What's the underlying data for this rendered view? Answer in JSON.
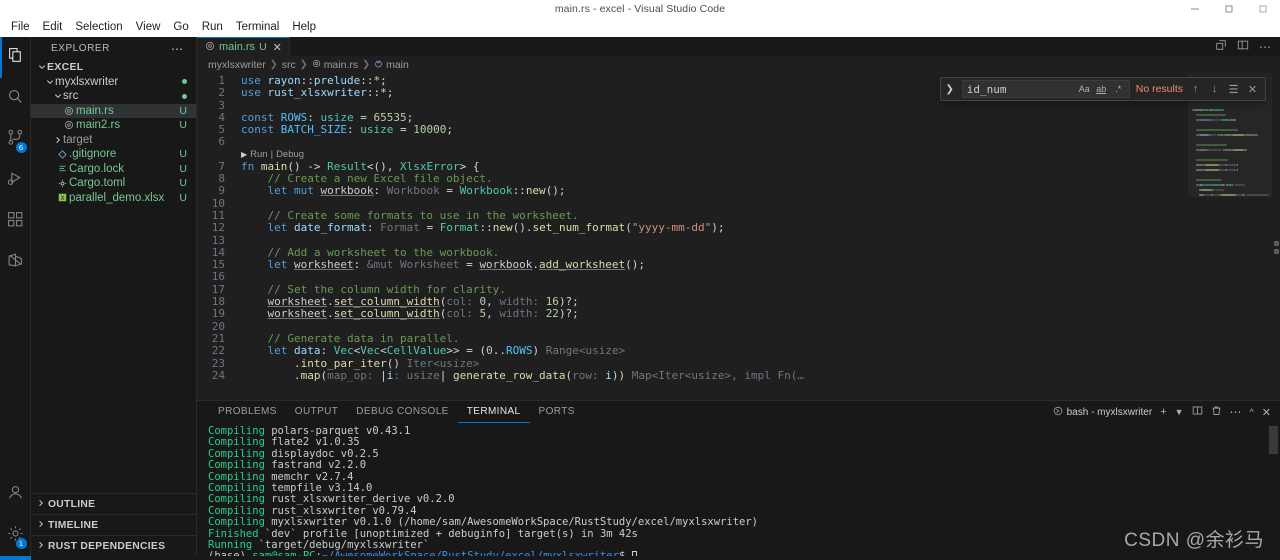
{
  "window": {
    "title": "main.rs - excel - Visual Studio Code",
    "controls": [
      "minimize",
      "maximize",
      "close"
    ]
  },
  "menubar": {
    "items": [
      "File",
      "Edit",
      "Selection",
      "View",
      "Go",
      "Run",
      "Terminal",
      "Help"
    ]
  },
  "activitybar": {
    "items": [
      {
        "name": "explorer",
        "icon": "files-icon",
        "active": true,
        "badge": ""
      },
      {
        "name": "search",
        "icon": "search-icon",
        "active": false,
        "badge": ""
      },
      {
        "name": "source-control",
        "icon": "source-control-icon",
        "active": false,
        "badge": "6"
      },
      {
        "name": "run-and-debug",
        "icon": "run-debug-icon",
        "active": false,
        "badge": ""
      },
      {
        "name": "extensions",
        "icon": "extensions-icon",
        "active": false,
        "badge": ""
      },
      {
        "name": "remote-explorer",
        "icon": "remote-icon",
        "active": false,
        "badge": ""
      }
    ],
    "bottom": [
      {
        "name": "accounts",
        "icon": "account-icon",
        "badge": ""
      },
      {
        "name": "manage",
        "icon": "gear-icon",
        "badge": "1"
      }
    ]
  },
  "sidebar": {
    "header": "EXPLORER",
    "more_label": "⋯",
    "root": "EXCEL",
    "tree": [
      {
        "label": "myxlsxwriter",
        "indent": 1,
        "type": "folder",
        "expanded": true,
        "badge": "",
        "dot": true,
        "icon": ""
      },
      {
        "label": "src",
        "indent": 2,
        "type": "folder",
        "expanded": true,
        "badge": "",
        "dot": true,
        "icon": ""
      },
      {
        "label": "main.rs",
        "indent": 3,
        "type": "file",
        "expanded": false,
        "badge": "U",
        "dot": false,
        "icon": "rust-icon",
        "selected": true
      },
      {
        "label": "main2.rs",
        "indent": 3,
        "type": "file",
        "expanded": false,
        "badge": "U",
        "dot": false,
        "icon": "rust-icon"
      },
      {
        "label": "target",
        "indent": 2,
        "type": "folder",
        "expanded": false,
        "badge": "",
        "dot": false,
        "icon": ""
      },
      {
        "label": ".gitignore",
        "indent": 2,
        "type": "file",
        "expanded": false,
        "badge": "U",
        "dot": false,
        "icon": "git-icon"
      },
      {
        "label": "Cargo.lock",
        "indent": 2,
        "type": "file",
        "expanded": false,
        "badge": "U",
        "dot": false,
        "icon": "lock-icon"
      },
      {
        "label": "Cargo.toml",
        "indent": 2,
        "type": "file",
        "expanded": false,
        "badge": "U",
        "dot": false,
        "icon": "toml-icon"
      },
      {
        "label": "parallel_demo.xlsx",
        "indent": 2,
        "type": "file",
        "expanded": false,
        "badge": "U",
        "dot": false,
        "icon": "excel-icon"
      }
    ],
    "sections": [
      "OUTLINE",
      "TIMELINE",
      "RUST DEPENDENCIES"
    ]
  },
  "editor": {
    "tab": {
      "label": "main.rs",
      "dirty_badge": "U",
      "close": "✕",
      "icon": "rust-icon"
    },
    "tab_actions": [
      "split-editor-icon",
      "layout-icon",
      "more-actions-icon"
    ],
    "breadcrumb": [
      "myxlsxwriter",
      "src",
      "main.rs",
      "main"
    ],
    "codelens": {
      "run": "Run",
      "sep": "|",
      "debug": "Debug"
    },
    "lines": [
      {
        "n": "1",
        "segs": [
          [
            "kw",
            "use "
          ],
          [
            "var",
            "rayon"
          ],
          [
            "op",
            "::"
          ],
          [
            "var",
            "prelude"
          ],
          [
            "op",
            "::*;"
          ]
        ]
      },
      {
        "n": "2",
        "segs": [
          [
            "kw",
            "use "
          ],
          [
            "var",
            "rust_xlsxwriter"
          ],
          [
            "op",
            "::*;"
          ]
        ]
      },
      {
        "n": "3",
        "segs": []
      },
      {
        "n": "4",
        "segs": [
          [
            "kw",
            "const "
          ],
          [
            "cst",
            "ROWS"
          ],
          [
            "op",
            ": "
          ],
          [
            "ty",
            "usize"
          ],
          [
            "op",
            " = "
          ],
          [
            "num",
            "65535"
          ],
          [
            "op",
            ";"
          ]
        ]
      },
      {
        "n": "5",
        "segs": [
          [
            "kw",
            "const "
          ],
          [
            "cst",
            "BATCH_SIZE"
          ],
          [
            "op",
            ": "
          ],
          [
            "ty",
            "usize"
          ],
          [
            "op",
            " = "
          ],
          [
            "num",
            "10000"
          ],
          [
            "op",
            ";"
          ]
        ]
      },
      {
        "n": "6",
        "segs": []
      },
      {
        "n": "7",
        "segs": [
          [
            "kw",
            "fn "
          ],
          [
            "fn",
            "main"
          ],
          [
            "op",
            "() -> "
          ],
          [
            "ty",
            "Result"
          ],
          [
            "op",
            "<(), "
          ],
          [
            "ty",
            "XlsxError"
          ],
          [
            "op",
            "> {"
          ]
        ],
        "codelens": true
      },
      {
        "n": "8",
        "segs": [
          [
            "cmt",
            "    // Create a new Excel file object."
          ]
        ]
      },
      {
        "n": "9",
        "segs": [
          [
            "kw",
            "    let "
          ],
          [
            "kw",
            "mut "
          ],
          [
            "und",
            "workbook"
          ],
          [
            "op",
            ": "
          ],
          [
            "ghost",
            "Workbook"
          ],
          [
            "op",
            " = "
          ],
          [
            "ty",
            "Workbook"
          ],
          [
            "op",
            "::"
          ],
          [
            "fn",
            "new"
          ],
          [
            "op",
            "();"
          ]
        ]
      },
      {
        "n": "10",
        "segs": []
      },
      {
        "n": "11",
        "segs": [
          [
            "cmt",
            "    // Create some formats to use in the worksheet."
          ]
        ]
      },
      {
        "n": "12",
        "segs": [
          [
            "kw",
            "    let "
          ],
          [
            "var",
            "date_format"
          ],
          [
            "op",
            ": "
          ],
          [
            "ghost",
            "Format"
          ],
          [
            "op",
            " = "
          ],
          [
            "ty",
            "Format"
          ],
          [
            "op",
            "::"
          ],
          [
            "fn",
            "new"
          ],
          [
            "op",
            "()."
          ],
          [
            "fn",
            "set_num_format"
          ],
          [
            "op",
            "("
          ],
          [
            "str",
            "\"yyyy-mm-dd\""
          ],
          [
            "op",
            ");"
          ]
        ]
      },
      {
        "n": "13",
        "segs": []
      },
      {
        "n": "14",
        "segs": [
          [
            "cmt",
            "    // Add a worksheet to the workbook."
          ]
        ]
      },
      {
        "n": "15",
        "segs": [
          [
            "kw",
            "    let "
          ],
          [
            "und",
            "worksheet"
          ],
          [
            "op",
            ": "
          ],
          [
            "ghost",
            "&mut Worksheet"
          ],
          [
            "op",
            " = "
          ],
          [
            "und",
            "workbook"
          ],
          [
            "op",
            "."
          ],
          [
            "und-fn",
            "add_worksheet"
          ],
          [
            "op",
            "();"
          ]
        ]
      },
      {
        "n": "16",
        "segs": []
      },
      {
        "n": "17",
        "segs": [
          [
            "cmt",
            "    // Set the column width for clarity."
          ]
        ]
      },
      {
        "n": "18",
        "segs": [
          [
            "op",
            "    "
          ],
          [
            "und",
            "worksheet"
          ],
          [
            "op",
            "."
          ],
          [
            "und-fn",
            "set_column_width"
          ],
          [
            "op",
            "("
          ],
          [
            "ghost",
            "col: "
          ],
          [
            "num",
            "0"
          ],
          [
            "op",
            ", "
          ],
          [
            "ghost",
            "width: "
          ],
          [
            "num",
            "16"
          ],
          [
            "op",
            ")?;"
          ]
        ]
      },
      {
        "n": "19",
        "segs": [
          [
            "op",
            "    "
          ],
          [
            "und",
            "worksheet"
          ],
          [
            "op",
            "."
          ],
          [
            "und-fn",
            "set_column_width"
          ],
          [
            "op",
            "("
          ],
          [
            "ghost",
            "col: "
          ],
          [
            "num",
            "5"
          ],
          [
            "op",
            ", "
          ],
          [
            "ghost",
            "width: "
          ],
          [
            "num",
            "22"
          ],
          [
            "op",
            ")?;"
          ]
        ]
      },
      {
        "n": "20",
        "segs": []
      },
      {
        "n": "21",
        "segs": [
          [
            "cmt",
            "    // Generate data in parallel."
          ]
        ]
      },
      {
        "n": "22",
        "segs": [
          [
            "kw",
            "    let "
          ],
          [
            "var",
            "data"
          ],
          [
            "op",
            ": "
          ],
          [
            "ty",
            "Vec"
          ],
          [
            "op",
            "<"
          ],
          [
            "ty",
            "Vec"
          ],
          [
            "op",
            "<"
          ],
          [
            "ty",
            "CellValue"
          ],
          [
            "op",
            ">> = ("
          ],
          [
            "num",
            "0"
          ],
          [
            "op",
            ".."
          ],
          [
            "cst",
            "ROWS"
          ],
          [
            "op",
            ")"
          ],
          [
            "ghost",
            " Range<usize>"
          ]
        ]
      },
      {
        "n": "23",
        "segs": [
          [
            "op",
            "        ."
          ],
          [
            "fn",
            "into_par_iter"
          ],
          [
            "op",
            "()"
          ],
          [
            "ghost",
            " Iter<usize>"
          ]
        ]
      },
      {
        "n": "24",
        "segs": [
          [
            "op",
            "        ."
          ],
          [
            "fn",
            "map"
          ],
          [
            "op",
            "("
          ],
          [
            "ghost",
            "map_op: "
          ],
          [
            "op",
            "|"
          ],
          [
            "var",
            "i"
          ],
          [
            "ghost",
            ": usize"
          ],
          [
            "op",
            "| "
          ],
          [
            "fn",
            "generate_row_data"
          ],
          [
            "op",
            "("
          ],
          [
            "ghost",
            "row: "
          ],
          [
            "var",
            "i"
          ],
          [
            "op",
            "))"
          ],
          [
            "ghost",
            " Map<Iter<usize>, impl Fn(…"
          ]
        ]
      }
    ]
  },
  "find_widget": {
    "toggle_icon": "chevron-right-icon",
    "query": "id_num",
    "options": [
      {
        "name": "match-case",
        "glyph": "Aa"
      },
      {
        "name": "match-whole-word",
        "glyph": "ab"
      },
      {
        "name": "use-regex",
        "glyph": ".*"
      }
    ],
    "result_text": "No results",
    "buttons": [
      {
        "name": "previous-match",
        "glyph": "↑"
      },
      {
        "name": "next-match",
        "glyph": "↓"
      },
      {
        "name": "find-in-selection",
        "glyph": "☰"
      },
      {
        "name": "close-find",
        "glyph": "✕"
      }
    ]
  },
  "panel": {
    "tabs": [
      {
        "label": "PROBLEMS",
        "active": false
      },
      {
        "label": "OUTPUT",
        "active": false
      },
      {
        "label": "DEBUG CONSOLE",
        "active": false
      },
      {
        "label": "TERMINAL",
        "active": true
      },
      {
        "label": "PORTS",
        "active": false
      }
    ],
    "terminal_name": "bash - myxlsxwriter",
    "actions": [
      {
        "name": "new-terminal",
        "glyph": "+"
      },
      {
        "name": "terminal-dropdown",
        "glyph": "⌄"
      },
      {
        "name": "split-terminal",
        "glyph": "◫"
      },
      {
        "name": "kill-terminal",
        "glyph": "Ὕ1"
      },
      {
        "name": "panel-more",
        "glyph": "⋯"
      },
      {
        "name": "maximize-panel",
        "glyph": "⌃"
      },
      {
        "name": "close-panel",
        "glyph": "✕"
      }
    ],
    "terminal_lines": [
      {
        "segs": [
          [
            "t-green",
            "   Compiling "
          ],
          [
            "t-plain",
            "polars-parquet v0.43.1"
          ]
        ]
      },
      {
        "segs": [
          [
            "t-green",
            "   Compiling "
          ],
          [
            "t-plain",
            "flate2 v1.0.35"
          ]
        ]
      },
      {
        "segs": [
          [
            "t-green",
            "   Compiling "
          ],
          [
            "t-plain",
            "displaydoc v0.2.5"
          ]
        ]
      },
      {
        "segs": [
          [
            "t-green",
            "   Compiling "
          ],
          [
            "t-plain",
            "fastrand v2.2.0"
          ]
        ]
      },
      {
        "segs": [
          [
            "t-green",
            "   Compiling "
          ],
          [
            "t-plain",
            "memchr v2.7.4"
          ]
        ]
      },
      {
        "segs": [
          [
            "t-green",
            "   Compiling "
          ],
          [
            "t-plain",
            "tempfile v3.14.0"
          ]
        ]
      },
      {
        "segs": [
          [
            "t-green",
            "   Compiling "
          ],
          [
            "t-plain",
            "rust_xlsxwriter_derive v0.2.0"
          ]
        ]
      },
      {
        "segs": [
          [
            "t-green",
            "   Compiling "
          ],
          [
            "t-plain",
            "rust_xlsxwriter v0.79.4"
          ]
        ]
      },
      {
        "segs": [
          [
            "t-green",
            "   Compiling "
          ],
          [
            "t-plain",
            "myxlsxwriter v0.1.0 (/home/sam/AwesomeWorkSpace/RustStudy/excel/myxlsxwriter)"
          ]
        ]
      },
      {
        "segs": [
          [
            "t-green",
            "    Finished "
          ],
          [
            "t-plain",
            "`dev` profile [unoptimized + debuginfo] target(s) in 3m 42s"
          ]
        ]
      },
      {
        "segs": [
          [
            "t-green",
            "     Running "
          ],
          [
            "t-plain",
            "`target/debug/myxlsxwriter`"
          ]
        ]
      },
      {
        "segs": [
          [
            "t-plain",
            "(base) "
          ],
          [
            "t-green",
            "sam@sam-PC"
          ],
          [
            "t-plain",
            ":"
          ],
          [
            "t-blue",
            "~/AwesomeWorkSpace/RustStudy/excel/myxlsxwriter"
          ],
          [
            "t-plain",
            "$ "
          ]
        ],
        "cursor": true
      }
    ]
  },
  "watermark": "CSDN @余衫马"
}
